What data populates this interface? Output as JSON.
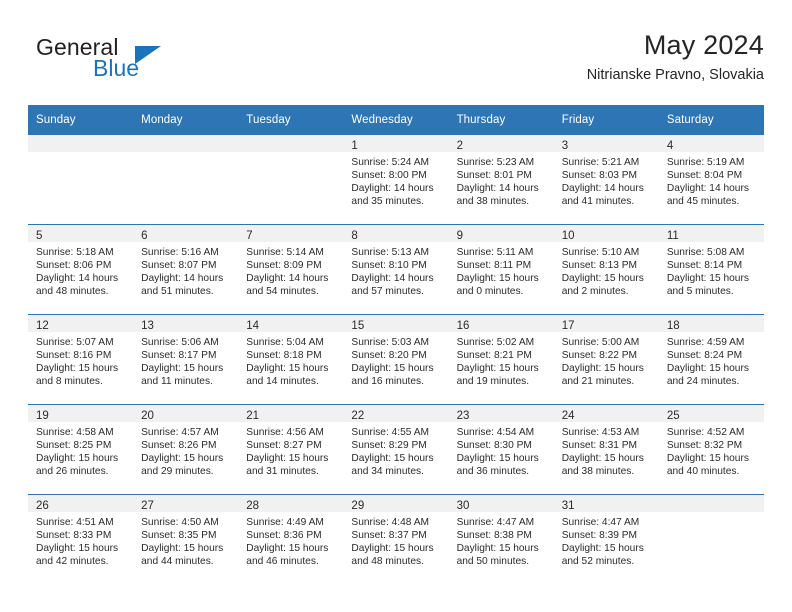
{
  "brand": {
    "name_top": "General",
    "name_bottom": "Blue",
    "accent_color": "#1b74bb"
  },
  "header": {
    "title": "May 2024",
    "subtitle": "Nitrianske Pravno, Slovakia"
  },
  "theme": {
    "header_row_color": "#2e75b6",
    "daynum_band_color": "#f1f1f1",
    "text_color": "#2b2b2b"
  },
  "weekdays": [
    "Sunday",
    "Monday",
    "Tuesday",
    "Wednesday",
    "Thursday",
    "Friday",
    "Saturday"
  ],
  "weeks": [
    [
      {
        "day": ""
      },
      {
        "day": ""
      },
      {
        "day": ""
      },
      {
        "day": "1",
        "sunrise": "Sunrise: 5:24 AM",
        "sunset": "Sunset: 8:00 PM",
        "daylight": "Daylight: 14 hours and 35 minutes."
      },
      {
        "day": "2",
        "sunrise": "Sunrise: 5:23 AM",
        "sunset": "Sunset: 8:01 PM",
        "daylight": "Daylight: 14 hours and 38 minutes."
      },
      {
        "day": "3",
        "sunrise": "Sunrise: 5:21 AM",
        "sunset": "Sunset: 8:03 PM",
        "daylight": "Daylight: 14 hours and 41 minutes."
      },
      {
        "day": "4",
        "sunrise": "Sunrise: 5:19 AM",
        "sunset": "Sunset: 8:04 PM",
        "daylight": "Daylight: 14 hours and 45 minutes."
      }
    ],
    [
      {
        "day": "5",
        "sunrise": "Sunrise: 5:18 AM",
        "sunset": "Sunset: 8:06 PM",
        "daylight": "Daylight: 14 hours and 48 minutes."
      },
      {
        "day": "6",
        "sunrise": "Sunrise: 5:16 AM",
        "sunset": "Sunset: 8:07 PM",
        "daylight": "Daylight: 14 hours and 51 minutes."
      },
      {
        "day": "7",
        "sunrise": "Sunrise: 5:14 AM",
        "sunset": "Sunset: 8:09 PM",
        "daylight": "Daylight: 14 hours and 54 minutes."
      },
      {
        "day": "8",
        "sunrise": "Sunrise: 5:13 AM",
        "sunset": "Sunset: 8:10 PM",
        "daylight": "Daylight: 14 hours and 57 minutes."
      },
      {
        "day": "9",
        "sunrise": "Sunrise: 5:11 AM",
        "sunset": "Sunset: 8:11 PM",
        "daylight": "Daylight: 15 hours and 0 minutes."
      },
      {
        "day": "10",
        "sunrise": "Sunrise: 5:10 AM",
        "sunset": "Sunset: 8:13 PM",
        "daylight": "Daylight: 15 hours and 2 minutes."
      },
      {
        "day": "11",
        "sunrise": "Sunrise: 5:08 AM",
        "sunset": "Sunset: 8:14 PM",
        "daylight": "Daylight: 15 hours and 5 minutes."
      }
    ],
    [
      {
        "day": "12",
        "sunrise": "Sunrise: 5:07 AM",
        "sunset": "Sunset: 8:16 PM",
        "daylight": "Daylight: 15 hours and 8 minutes."
      },
      {
        "day": "13",
        "sunrise": "Sunrise: 5:06 AM",
        "sunset": "Sunset: 8:17 PM",
        "daylight": "Daylight: 15 hours and 11 minutes."
      },
      {
        "day": "14",
        "sunrise": "Sunrise: 5:04 AM",
        "sunset": "Sunset: 8:18 PM",
        "daylight": "Daylight: 15 hours and 14 minutes."
      },
      {
        "day": "15",
        "sunrise": "Sunrise: 5:03 AM",
        "sunset": "Sunset: 8:20 PM",
        "daylight": "Daylight: 15 hours and 16 minutes."
      },
      {
        "day": "16",
        "sunrise": "Sunrise: 5:02 AM",
        "sunset": "Sunset: 8:21 PM",
        "daylight": "Daylight: 15 hours and 19 minutes."
      },
      {
        "day": "17",
        "sunrise": "Sunrise: 5:00 AM",
        "sunset": "Sunset: 8:22 PM",
        "daylight": "Daylight: 15 hours and 21 minutes."
      },
      {
        "day": "18",
        "sunrise": "Sunrise: 4:59 AM",
        "sunset": "Sunset: 8:24 PM",
        "daylight": "Daylight: 15 hours and 24 minutes."
      }
    ],
    [
      {
        "day": "19",
        "sunrise": "Sunrise: 4:58 AM",
        "sunset": "Sunset: 8:25 PM",
        "daylight": "Daylight: 15 hours and 26 minutes."
      },
      {
        "day": "20",
        "sunrise": "Sunrise: 4:57 AM",
        "sunset": "Sunset: 8:26 PM",
        "daylight": "Daylight: 15 hours and 29 minutes."
      },
      {
        "day": "21",
        "sunrise": "Sunrise: 4:56 AM",
        "sunset": "Sunset: 8:27 PM",
        "daylight": "Daylight: 15 hours and 31 minutes."
      },
      {
        "day": "22",
        "sunrise": "Sunrise: 4:55 AM",
        "sunset": "Sunset: 8:29 PM",
        "daylight": "Daylight: 15 hours and 34 minutes."
      },
      {
        "day": "23",
        "sunrise": "Sunrise: 4:54 AM",
        "sunset": "Sunset: 8:30 PM",
        "daylight": "Daylight: 15 hours and 36 minutes."
      },
      {
        "day": "24",
        "sunrise": "Sunrise: 4:53 AM",
        "sunset": "Sunset: 8:31 PM",
        "daylight": "Daylight: 15 hours and 38 minutes."
      },
      {
        "day": "25",
        "sunrise": "Sunrise: 4:52 AM",
        "sunset": "Sunset: 8:32 PM",
        "daylight": "Daylight: 15 hours and 40 minutes."
      }
    ],
    [
      {
        "day": "26",
        "sunrise": "Sunrise: 4:51 AM",
        "sunset": "Sunset: 8:33 PM",
        "daylight": "Daylight: 15 hours and 42 minutes."
      },
      {
        "day": "27",
        "sunrise": "Sunrise: 4:50 AM",
        "sunset": "Sunset: 8:35 PM",
        "daylight": "Daylight: 15 hours and 44 minutes."
      },
      {
        "day": "28",
        "sunrise": "Sunrise: 4:49 AM",
        "sunset": "Sunset: 8:36 PM",
        "daylight": "Daylight: 15 hours and 46 minutes."
      },
      {
        "day": "29",
        "sunrise": "Sunrise: 4:48 AM",
        "sunset": "Sunset: 8:37 PM",
        "daylight": "Daylight: 15 hours and 48 minutes."
      },
      {
        "day": "30",
        "sunrise": "Sunrise: 4:47 AM",
        "sunset": "Sunset: 8:38 PM",
        "daylight": "Daylight: 15 hours and 50 minutes."
      },
      {
        "day": "31",
        "sunrise": "Sunrise: 4:47 AM",
        "sunset": "Sunset: 8:39 PM",
        "daylight": "Daylight: 15 hours and 52 minutes."
      },
      {
        "day": ""
      }
    ]
  ]
}
